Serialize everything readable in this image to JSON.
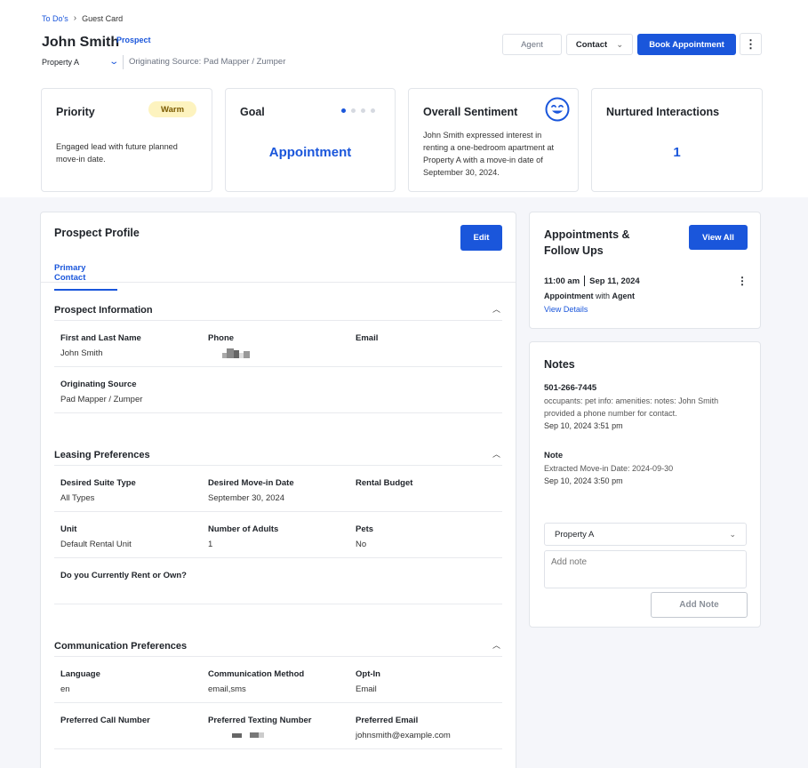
{
  "breadcrumb": {
    "parent": "To Do's",
    "separator": "›",
    "current": "Guest Card"
  },
  "header": {
    "name": "John Smith",
    "status": "Prospect",
    "property_select": "Property A",
    "originating_source": "Originating Source: Pad Mapper / Zumper"
  },
  "actions": {
    "agent": "Agent",
    "contact": "Contact",
    "book": "Book Appointment",
    "more": "⋮"
  },
  "kpis": {
    "priority": {
      "title": "Priority",
      "badge": "Warm",
      "text": "Engaged lead with future planned move-in date."
    },
    "goal": {
      "title": "Goal",
      "value": "Appointment",
      "step_current": 1,
      "step_total": 4
    },
    "sentiment": {
      "title": "Overall Sentiment",
      "text": "John Smith expressed interest in renting a one-bedroom apartment at Property A with a move-in date of September 30, 2024.",
      "icon": "smiley-face-icon"
    },
    "nurtured": {
      "title": "Nurtured Interactions",
      "value": "1"
    }
  },
  "profile": {
    "title": "Prospect Profile",
    "edit": "Edit",
    "tab": "Primary Contact",
    "prospect_info": {
      "title": "Prospect Information",
      "name_label": "First and Last Name",
      "name_value": "John Smith",
      "phone_label": "Phone",
      "email_label": "Email",
      "source_label": "Originating Source",
      "source_value": "Pad Mapper / Zumper"
    },
    "leasing": {
      "title": "Leasing Preferences",
      "suite_label": "Desired Suite Type",
      "suite_value": "All Types",
      "movein_label": "Desired Move-in Date",
      "movein_value": "September 30, 2024",
      "budget_label": "Rental Budget",
      "unit_label": "Unit",
      "unit_value": "Default Rental Unit",
      "adults_label": "Number of Adults",
      "adults_value": "1",
      "pets_label": "Pets",
      "pets_value": "No",
      "rent_own_label": "Do you Currently Rent or Own?"
    },
    "communication": {
      "title": "Communication Preferences",
      "language_label": "Language",
      "language_value": "en",
      "method_label": "Communication Method",
      "method_value": "email,sms",
      "optin_label": "Opt-In",
      "optin_value": "Email",
      "call_label": "Preferred Call Number",
      "text_label": "Preferred Texting Number",
      "email_label": "Preferred Email",
      "email_value": "johnsmith@example.com"
    }
  },
  "appointments": {
    "title": "Appointments & Follow Ups",
    "view_all": "View All",
    "time": "11:00 am",
    "date": "Sep 11, 2024",
    "type": "Appointment",
    "with_word": "with",
    "with": "Agent",
    "details": "View Details"
  },
  "notes": {
    "title": "Notes",
    "items": [
      {
        "heading": "501-266-7445",
        "body": "occupants: pet info: amenities: notes: John Smith provided a phone number for contact.",
        "date": "Sep 10, 2024 3:51 pm"
      },
      {
        "heading": "Note",
        "body": "Extracted Move-in Date: 2024-09-30",
        "date": "Sep 10, 2024 3:50 pm"
      }
    ],
    "property_select": "Property A",
    "placeholder": "Add note",
    "add_button": "Add Note"
  },
  "colors": {
    "accent": "#1a56db",
    "warm_badge": "#fdf3bf"
  }
}
